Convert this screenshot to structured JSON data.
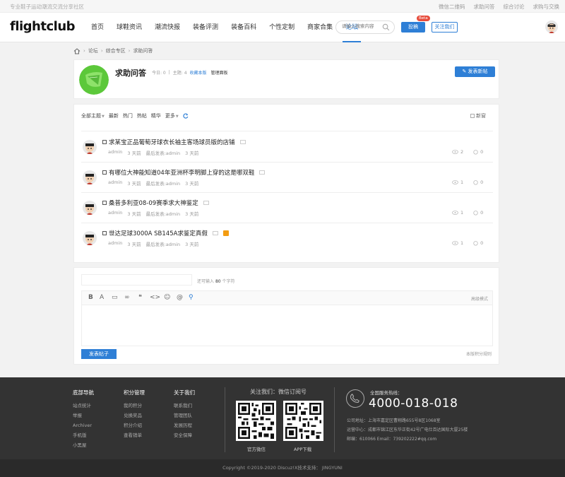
{
  "topbar": {
    "slogan": "专业鞋子运动潮流交流分享社区",
    "links": [
      "微信二维码",
      "求助问答",
      "综合讨论",
      "求购与交换"
    ]
  },
  "header": {
    "logo": "flightclub",
    "nav": [
      "首页",
      "球鞋资讯",
      "潮流快报",
      "装备评测",
      "装备百科",
      "个性定制",
      "商家合集",
      "论坛"
    ],
    "active_nav": "论坛",
    "search_placeholder": "请输入搜索内容",
    "post_label": "投稿",
    "beta_label": "Beta",
    "follow_label": "关注我们"
  },
  "breadcrumb": [
    "论坛",
    "综合专区",
    "求助问答"
  ],
  "forum": {
    "title": "求助问答",
    "today": "今日: 0",
    "topics": "主题: 4",
    "favorite": "收藏本版",
    "manage": "管理面板",
    "new_post": "发表新帖"
  },
  "filters": {
    "items": [
      "全部主题",
      "最新",
      "热门",
      "热帖",
      "精华",
      "更多"
    ],
    "new_window": "新窗"
  },
  "threads": [
    {
      "title": "求某宝正品葡萄牙球衣长袖主客场球员版的店铺",
      "author": "admin",
      "time": "3 天前",
      "last": "最后发表:admin",
      "last_time": "3 天前",
      "views": "2",
      "replies": "0",
      "rss": false
    },
    {
      "title": "有哪位大神能知道04年亚洲杯李明脚上穿的这是哪双鞋",
      "author": "admin",
      "time": "3 天前",
      "last": "最后发表:admin",
      "last_time": "3 天前",
      "views": "1",
      "replies": "0",
      "rss": false
    },
    {
      "title": "桑普多利亚08-09赛季求大神鉴定",
      "author": "admin",
      "time": "3 天前",
      "last": "最后发表:admin",
      "last_time": "3 天前",
      "views": "1",
      "replies": "0",
      "rss": false
    },
    {
      "title": "世达足球3000A SB145A求鉴定真假",
      "author": "admin",
      "time": "3 天前",
      "last": "最后发表:admin",
      "last_time": "3 天前",
      "views": "1",
      "replies": "0",
      "rss": true
    }
  ],
  "reply": {
    "hint_prefix": "还可输入",
    "hint_count": "80",
    "hint_suffix": "个字符",
    "advanced": "高级模式",
    "submit": "发表帖子",
    "rules": "本版积分规则",
    "toolbar": [
      "B",
      "A",
      "▭",
      "∞",
      "❝",
      "<>",
      "☺",
      "@",
      "⚲"
    ]
  },
  "footer": {
    "cols": [
      {
        "h": "底部导航",
        "items": [
          "站点统计",
          "举报",
          "Archiver",
          "手机版",
          "小黑屋"
        ]
      },
      {
        "h": "积分管理",
        "items": [
          "我的积分",
          "兑换奖品",
          "积分介绍",
          "查看销单"
        ]
      },
      {
        "h": "关于我们",
        "items": [
          "联系我们",
          "管理团队",
          "发展历程",
          "安全保障"
        ]
      }
    ],
    "follow_title": "关注我们：微信订阅号",
    "qr1_label": "官方微信",
    "qr2_label": "APP下载",
    "hotline_label": "全国服务热线：",
    "hotline": "4000-018-018",
    "address1": "公司地址：上海市嘉定区曹翔路655号8区1068室",
    "address2": "运营中心：成都市锦江区东华正街42号广电仕百达国际大厦25楼",
    "address3": "邮编：610066 Email：739202222#qq.com",
    "copyright": "Copyright  ©2019-2020  Discuz!X技术支持：  JINGYUNI"
  },
  "colors": {
    "accent": "#2e7fd6",
    "footer_bg": "#333333"
  }
}
